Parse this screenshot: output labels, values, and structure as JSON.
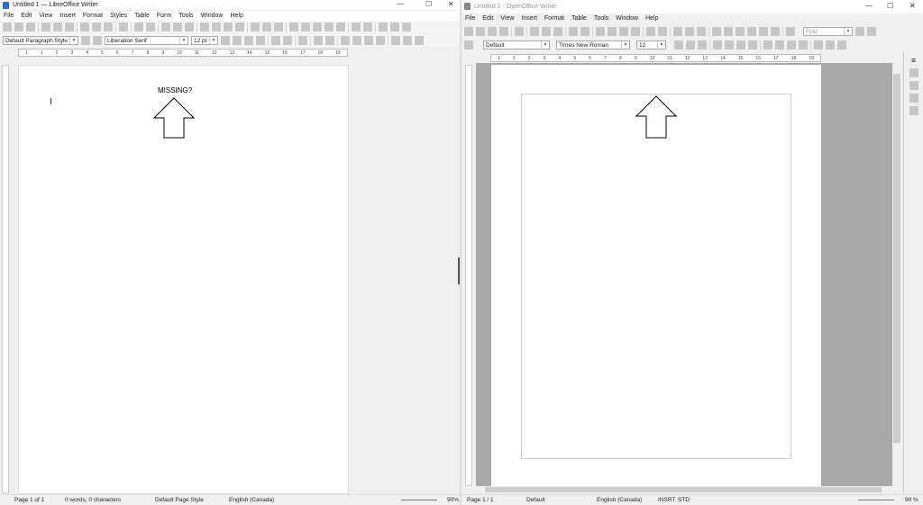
{
  "left": {
    "title": "Untitled 1 — LibreOffice Writer",
    "menu": [
      "File",
      "Edit",
      "View",
      "Insert",
      "Format",
      "Styles",
      "Table",
      "Form",
      "Tools",
      "Window",
      "Help"
    ],
    "toolbar1_icons": [
      "new-icon",
      "open-icon",
      "save-icon",
      "sep",
      "export-pdf-icon",
      "print-icon",
      "print-preview-icon",
      "sep",
      "cut-icon",
      "copy-icon",
      "paste-icon",
      "sep",
      "clone-formatting-icon",
      "sep",
      "undo-icon",
      "redo-icon",
      "sep",
      "find-replace-icon",
      "spellcheck-icon",
      "formatting-marks-icon",
      "sep",
      "table-icon",
      "image-icon",
      "chart-icon",
      "textbox-icon",
      "sep",
      "page-break-icon",
      "field-icon",
      "special-character-icon",
      "sep",
      "hyperlink-icon",
      "footnote-icon",
      "endnote-icon",
      "bookmark-icon",
      "cross-reference-icon",
      "sep",
      "comment-icon",
      "track-changes-icon",
      "sep",
      "line-icon",
      "shapes-icon",
      "draw-functions-icon"
    ],
    "paragraph_style": "Default Paragraph Style",
    "font_name": "Liberation Serif",
    "font_size": "12 pt",
    "toolbar2_icons": [
      "bold-icon",
      "italic-icon",
      "underline-icon",
      "strikethrough-icon",
      "sep",
      "superscript-icon",
      "subscript-icon",
      "sep",
      "clear-formatting-icon",
      "sep",
      "font-color-icon",
      "highlight-icon",
      "sep",
      "align-left-icon",
      "align-center-icon",
      "align-right-icon",
      "justify-icon",
      "sep",
      "bullets-icon",
      "numbering-icon",
      "outline-icon"
    ],
    "ruler_ticks": [
      "1",
      "1",
      "2",
      "3",
      "4",
      "5",
      "6",
      "7",
      "8",
      "9",
      "10",
      "11",
      "12",
      "13",
      "14",
      "15",
      "16",
      "17",
      "18",
      "19"
    ],
    "annotation": "MISSING?",
    "status": {
      "page": "Page 1 of 1",
      "words": "0 words, 0 characters",
      "page_style": "Default Page Style",
      "language": "English (Canada)",
      "zoom": "90%"
    }
  },
  "right": {
    "title": "Untitled 1 - OpenOffice Writer",
    "menu": [
      "File",
      "Edit",
      "View",
      "Insert",
      "Format",
      "Table",
      "Tools",
      "Window",
      "Help"
    ],
    "toolbar1_icons": [
      "new-icon",
      "open-icon",
      "save-icon",
      "email-icon",
      "sep",
      "edit-file-icon",
      "sep",
      "export-pdf-icon",
      "print-icon",
      "print-preview-icon",
      "sep",
      "spellcheck-icon",
      "autospellcheck-icon",
      "sep",
      "cut-icon",
      "copy-icon",
      "paste-icon",
      "clone-formatting-icon",
      "sep",
      "undo-icon",
      "redo-icon",
      "sep",
      "hyperlink-icon",
      "table-icon",
      "show-draw-functions-icon",
      "sep",
      "find-replace-icon",
      "navigator-icon",
      "gallery-icon",
      "data-sources-icon",
      "formatting-marks-icon",
      "zoom-icon",
      "sep",
      "help-icon"
    ],
    "find_placeholder": "Find",
    "paragraph_style": "Default",
    "font_name": "Times New Roman",
    "font_size": "12",
    "toolbar2_icons": [
      "bold-icon",
      "italic-icon",
      "underline-icon",
      "sep",
      "align-left-icon",
      "align-center-icon",
      "align-right-icon",
      "justify-icon",
      "sep",
      "numbering-icon",
      "bullets-icon",
      "decrease-indent-icon",
      "increase-indent-icon",
      "sep",
      "font-color-icon",
      "highlight-icon",
      "background-color-icon"
    ],
    "ruler_ticks": [
      "1",
      "1",
      "2",
      "3",
      "4",
      "5",
      "6",
      "7",
      "8",
      "9",
      "10",
      "11",
      "12",
      "13",
      "14",
      "15",
      "16",
      "17",
      "18",
      "19"
    ],
    "sidebar_icons": [
      "properties-icon",
      "styles-icon",
      "gallery-icon",
      "navigator-icon"
    ],
    "status": {
      "page": "Page 1 / 1",
      "page_style": "Default",
      "language": "English (Canada)",
      "insert_mode": "INSRT",
      "selection_mode": "STD",
      "zoom": "90 %"
    }
  }
}
